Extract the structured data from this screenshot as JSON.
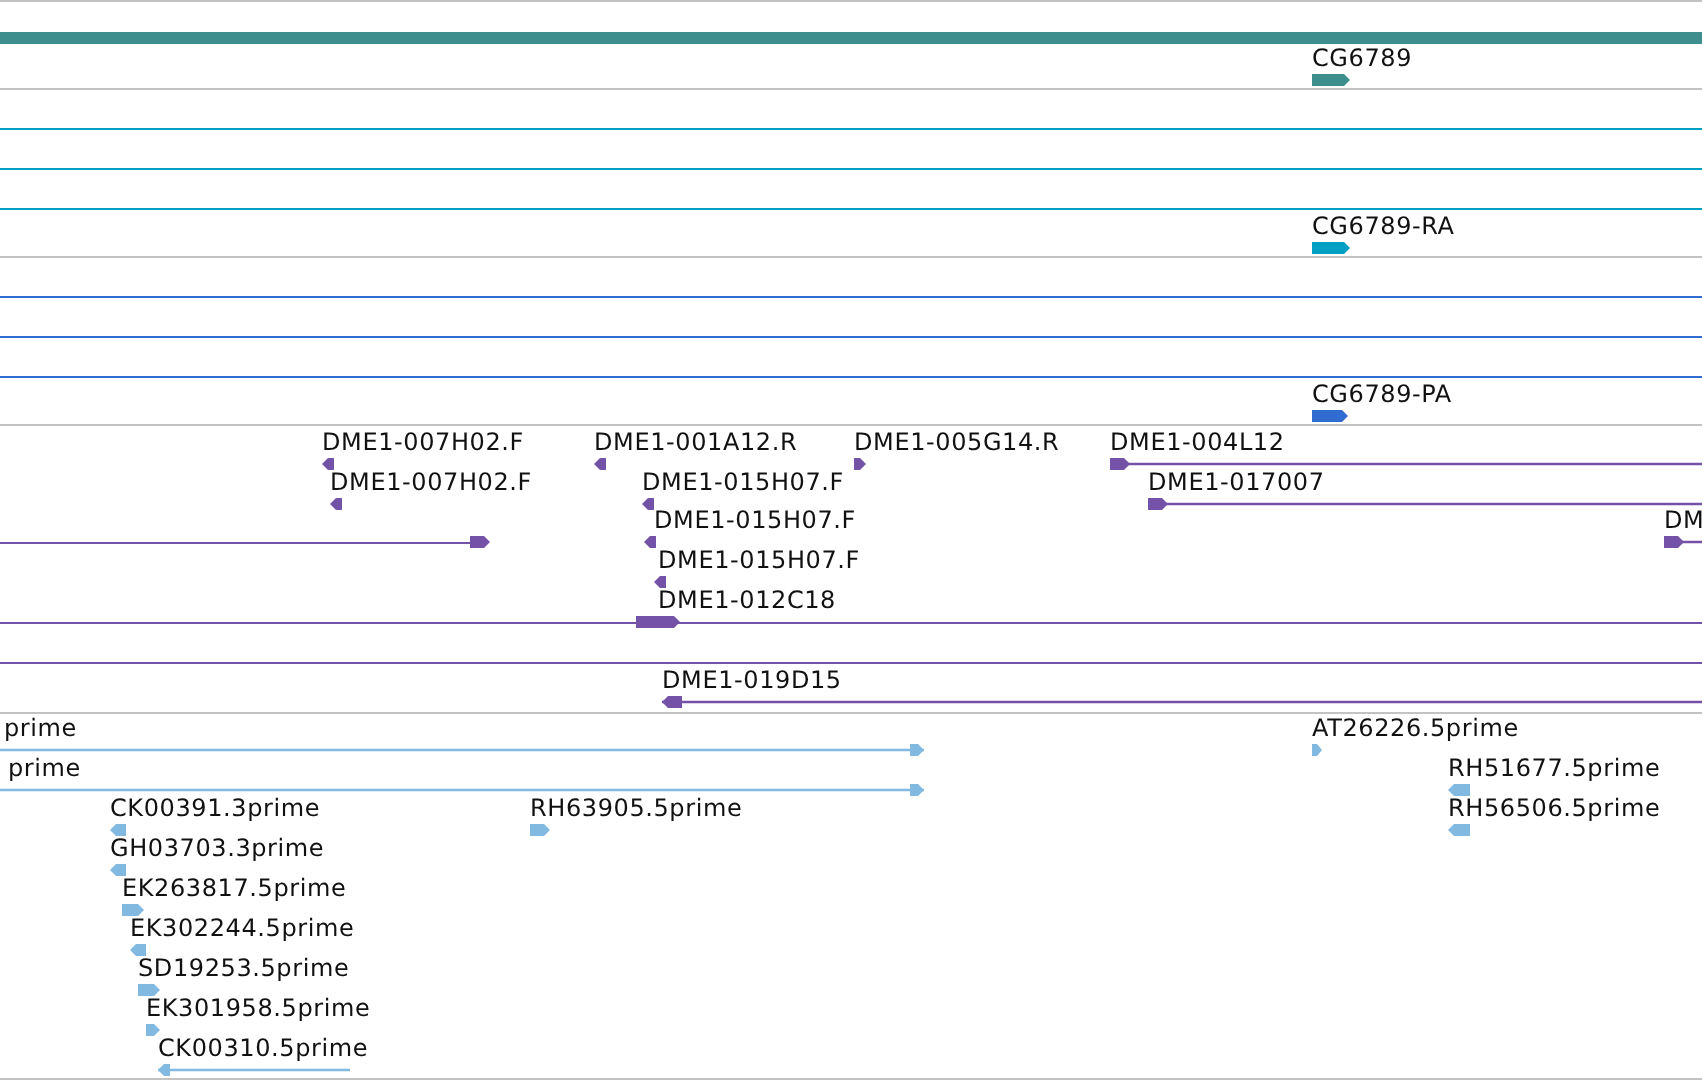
{
  "tracks": [
    {
      "color": "#3f8e8e",
      "features": [
        {
          "label": "CG6789",
          "reverse": false
        }
      ]
    },
    {
      "color": "#00a0c4",
      "features": [
        {
          "label": "CG6789-RA",
          "reverse": false
        }
      ]
    },
    {
      "color": "#2f6bd0",
      "features": [
        {
          "label": "CG6789-PA",
          "reverse": false
        }
      ]
    },
    {
      "color": "#7352a8",
      "features": [
        {
          "label": "DME1-007H02.F",
          "reverse": true
        },
        {
          "label": "DME1-001A12.R",
          "reverse": true
        },
        {
          "label": "DME1-005G14.R",
          "reverse": false
        },
        {
          "label": "DME1-004L12",
          "reverse": false
        },
        {
          "label": "DME1-007H02.F",
          "reverse": true
        },
        {
          "label": "DME1-015H07.F",
          "reverse": true
        },
        {
          "label": "DME1-017007",
          "reverse": false
        },
        {
          "label": "DME1-015H07.F",
          "reverse": true
        },
        {
          "label": "DM",
          "reverse": false
        },
        {
          "label": "DME1-015H07.F",
          "reverse": true
        },
        {
          "label": "DME1-012C18",
          "reverse": false
        },
        {
          "label": "DME1-019D15",
          "reverse": true
        }
      ]
    },
    {
      "color": "#82b9e0",
      "features": [
        {
          "label": "prime",
          "reverse": false
        },
        {
          "label": "AT26226.5prime",
          "reverse": false
        },
        {
          "label": "prime",
          "reverse": false
        },
        {
          "label": "RH51677.5prime",
          "reverse": true
        },
        {
          "label": "CK00391.3prime",
          "reverse": true
        },
        {
          "label": "RH63905.5prime",
          "reverse": false
        },
        {
          "label": "RH56506.5prime",
          "reverse": true
        },
        {
          "label": "GH03703.3prime",
          "reverse": true
        },
        {
          "label": "EK263817.5prime",
          "reverse": false
        },
        {
          "label": "EK302244.5prime",
          "reverse": true
        },
        {
          "label": "SD19253.5prime",
          "reverse": false
        },
        {
          "label": "EK301958.5prime",
          "reverse": false
        },
        {
          "label": "CK00310.5prime",
          "reverse": true
        }
      ]
    }
  ]
}
